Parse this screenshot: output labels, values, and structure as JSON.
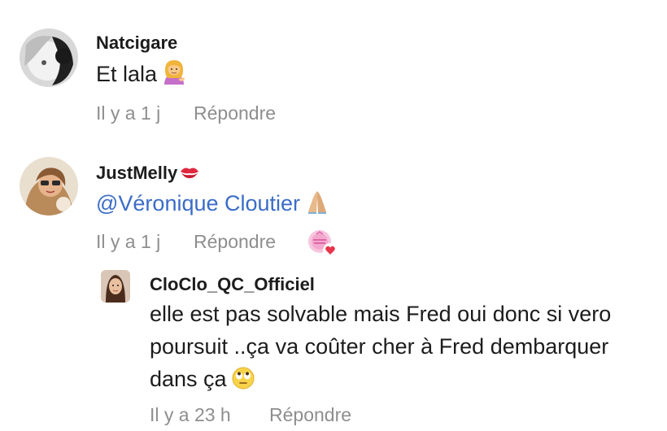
{
  "comments": [
    {
      "username": "Natcigare",
      "text": "Et lala",
      "emoji_icon": "woman-tipping-hand-emoji",
      "time": "Il y a 1 j",
      "reply_label": "Répondre"
    },
    {
      "username": "JustMelly",
      "username_emoji_icon": "kiss-mark-emoji",
      "mention": "@Véronique Cloutier",
      "emoji_icon": "folded-hands-emoji",
      "time": "Il y a 1 j",
      "reply_label": "Répondre",
      "reaction_badge_icon": "author-reaction-heart-badge"
    }
  ],
  "reply": {
    "username": "CloClo_QC_Officiel",
    "text_line1": "elle est pas solvable mais Fred oui donc si vero",
    "text_line2": "poursuit ..ça va coûter cher à Fred dembarquer",
    "text_line3": "dans ça",
    "emoji_icon": "face-with-rolling-eyes-emoji",
    "time": "Il y a 23 h",
    "reply_label": "Répondre"
  },
  "colors": {
    "mention": "#3b6cc7",
    "meta": "#8e8e8e",
    "heart": "#e8344d"
  }
}
